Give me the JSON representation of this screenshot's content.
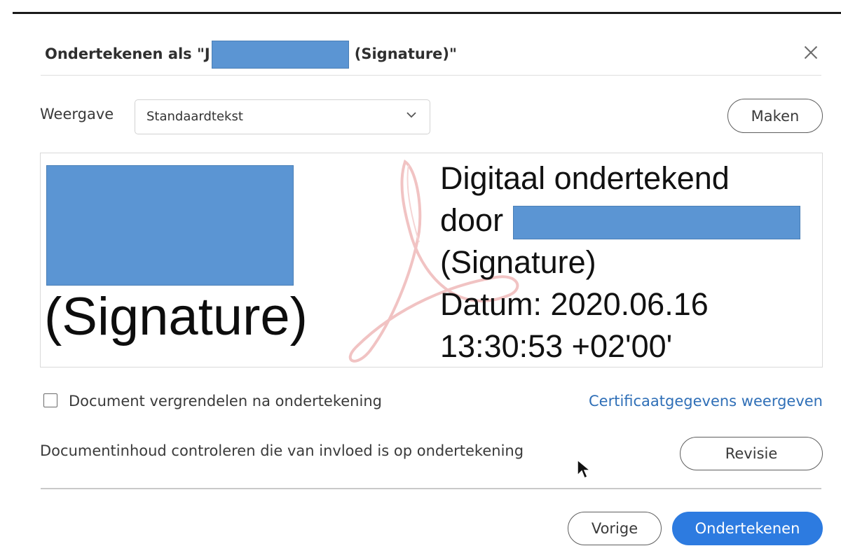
{
  "dialog": {
    "title_prefix": "Ondertekenen als \"J",
    "title_suffix": "(Signature)\"",
    "close_icon": "close-icon"
  },
  "appearance": {
    "label": "Weergave",
    "selected": "Standaardtekst",
    "create_button": "Maken"
  },
  "preview": {
    "name_text": "(Signature)",
    "details": {
      "line1": "Digitaal ondertekend",
      "line2": "door",
      "line3": "(Signature)",
      "line4": "Datum: 2020.06.16",
      "line5": "13:30:53 +02'00'"
    }
  },
  "options": {
    "lock_label": "Document vergrendelen na ondertekening",
    "lock_checked": false,
    "certificate_link": "Certificaatgegevens weergeven"
  },
  "review": {
    "text": "Documentinhoud controleren die van invloed is op ondertekening",
    "button": "Revisie"
  },
  "footer": {
    "back_button": "Vorige",
    "sign_button": "Ondertekenen"
  },
  "colors": {
    "primary": "#2d7be0",
    "link": "#2f6fb7",
    "redaction": "#5b95d3",
    "watermark": "#f2c6c6"
  }
}
